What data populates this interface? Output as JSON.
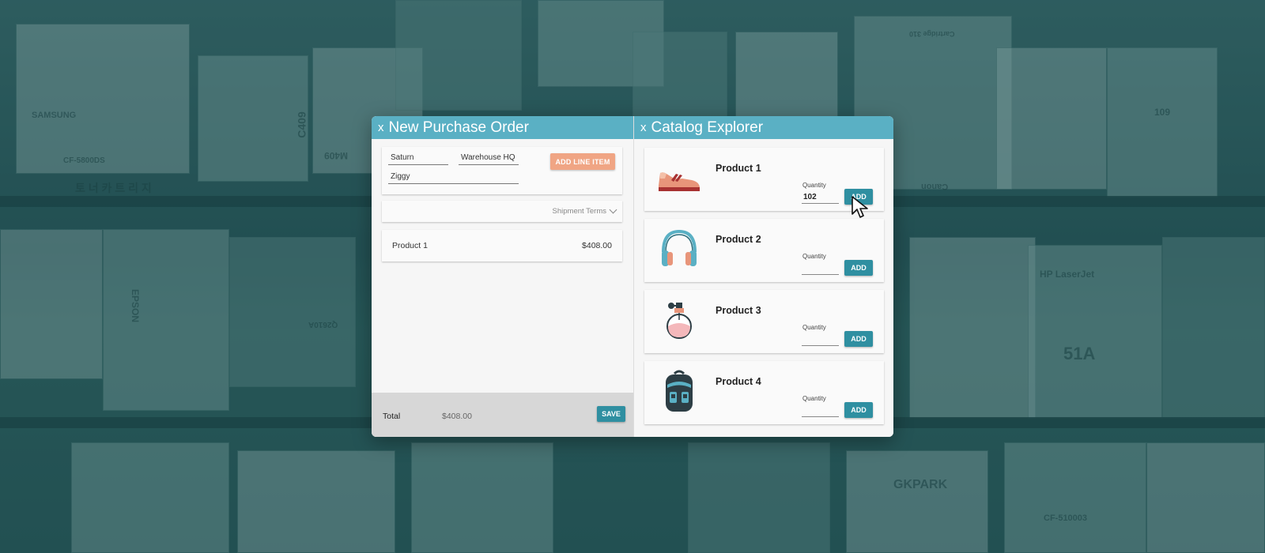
{
  "order_panel": {
    "title": "New Purchase Order",
    "close_label": "x",
    "fields": {
      "supplier": "Saturn",
      "location": "Warehouse HQ",
      "contact": "Ziggy"
    },
    "add_line_item_label": "ADD LINE ITEM",
    "shipment_terms_label": "Shipment Terms",
    "line_items": [
      {
        "name": "Product 1",
        "amount": "$408.00"
      }
    ],
    "footer": {
      "total_label": "Total",
      "total_value": "$408.00",
      "save_label": "SAVE"
    }
  },
  "catalog_panel": {
    "title": "Catalog Explorer",
    "close_label": "x",
    "quantity_label": "Quantity",
    "add_label": "ADD",
    "products": [
      {
        "name": "Product 1",
        "quantity": "102",
        "icon": "sneaker-icon"
      },
      {
        "name": "Product 2",
        "quantity": "",
        "icon": "headphones-icon"
      },
      {
        "name": "Product 3",
        "quantity": "",
        "icon": "perfume-bottle-icon"
      },
      {
        "name": "Product 4",
        "quantity": "",
        "icon": "backpack-icon"
      }
    ]
  },
  "background": {
    "box_labels": [
      "SAMSUNG",
      "C409",
      "EPSON",
      "HP LaserJet",
      "51A",
      "GKPARK",
      "CF-5800DS",
      "토 너 카 트 리 지",
      "109",
      "Cartridge 310",
      "Canon",
      "CF-510003",
      "M409",
      "Q2610A"
    ]
  },
  "colors": {
    "title_bar": "#5ab0c4",
    "accent_orange": "#f0a584",
    "accent_teal": "#2f8fa1",
    "footer_bg": "#d7d7d7"
  }
}
